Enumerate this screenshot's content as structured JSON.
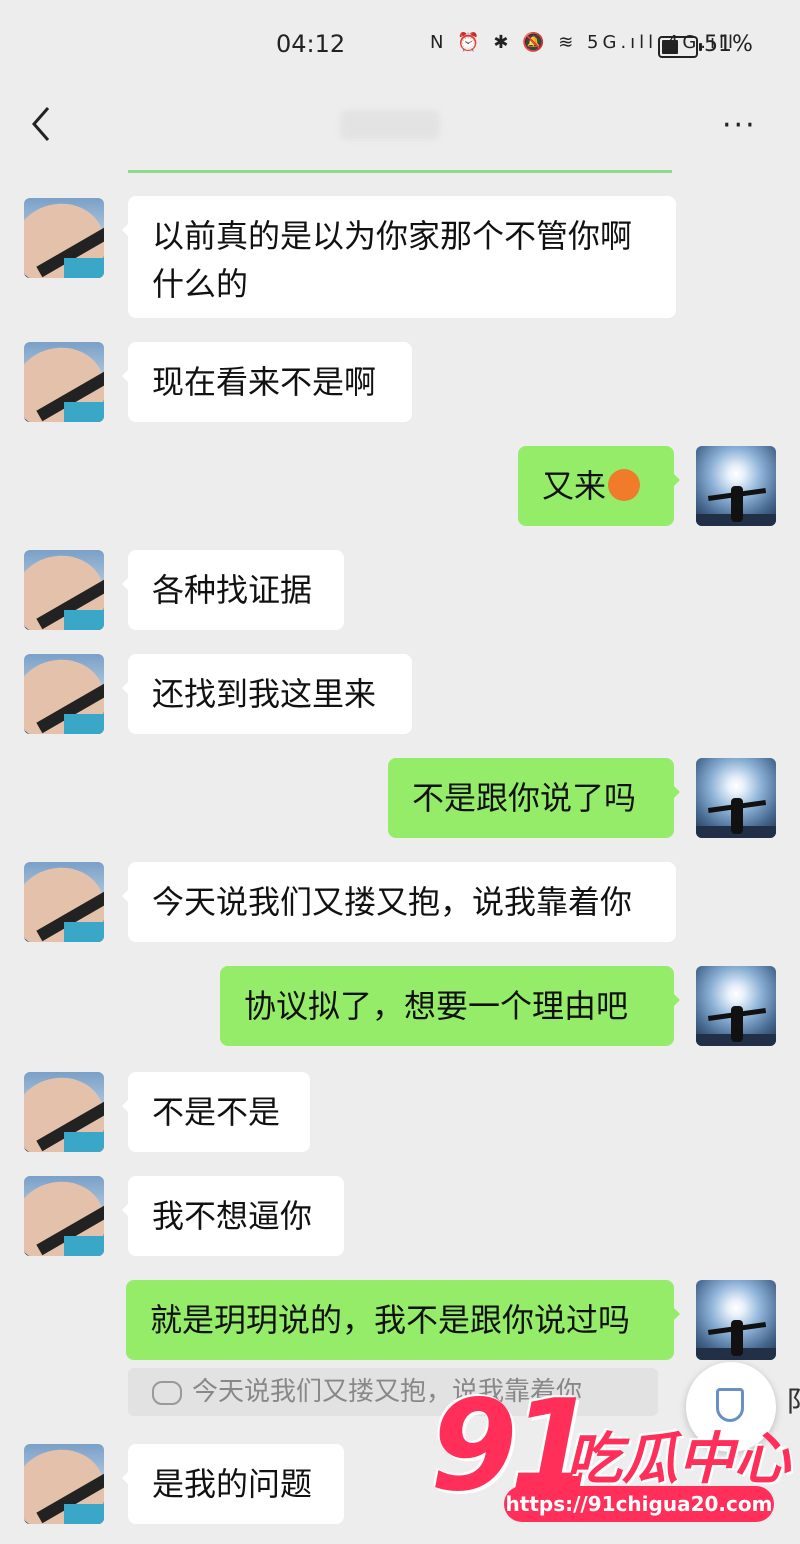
{
  "status_bar": {
    "time": "04:12",
    "icons_text": "N ⏰ ✱ 🔕 ≋ 5G.ıll 4G.ıll",
    "battery_percent": "51%",
    "battery_level": 0.51
  },
  "header": {
    "back_icon": "chevron-left-icon",
    "more_label": "···"
  },
  "messages": [
    {
      "side": "left",
      "text_lines": [
        "以前真的是以为你家那个不管你啊",
        "什么的"
      ]
    },
    {
      "side": "left",
      "text": "现在看来不是啊"
    },
    {
      "side": "right",
      "text": "又来",
      "emoji": "sweat-face-emoji"
    },
    {
      "side": "left",
      "text": "各种找证据"
    },
    {
      "side": "left",
      "text": "还找到我这里来"
    },
    {
      "side": "right",
      "text": "不是跟你说了吗"
    },
    {
      "side": "left",
      "text": "今天说我们又搂又抱，说我靠着你"
    },
    {
      "side": "right",
      "text": "协议拟了，想要一个理由吧"
    },
    {
      "side": "left",
      "text": "不是不是"
    },
    {
      "side": "left",
      "text": "我不想逼你"
    },
    {
      "side": "right",
      "text": "就是玥玥说的，我不是跟你说过吗",
      "quote": "今天说我们又搂又抱，说我靠着你"
    },
    {
      "side": "left",
      "text": "是我的问题"
    }
  ],
  "overlay": {
    "shield_icon": "shield-icon",
    "edge_text": "阝"
  },
  "watermark": {
    "number": "91",
    "name": "吃瓜中心",
    "url": "https://91chigua20.com"
  },
  "colors": {
    "background": "#ededed",
    "bubble_right": "#95ec69",
    "bubble_left": "#ffffff",
    "watermark": "#ff2f5a"
  }
}
